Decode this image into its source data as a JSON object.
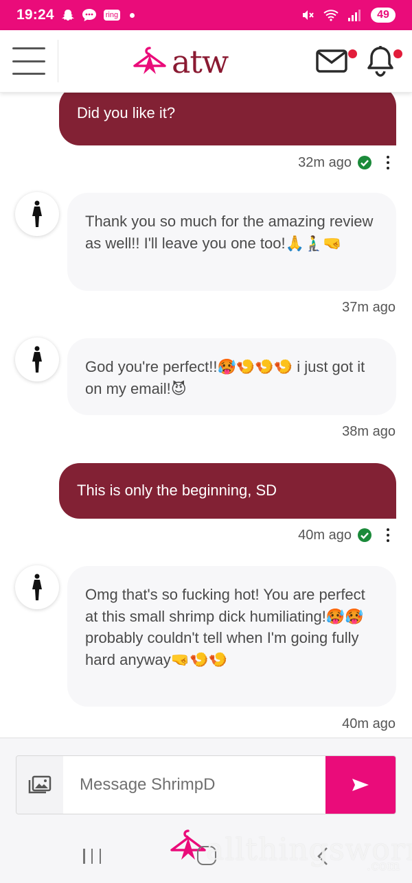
{
  "status_bar": {
    "time": "19:24",
    "ring_label": "ring",
    "battery": "49"
  },
  "header": {
    "logo_text": "atw",
    "brand_color": "#822134",
    "accent_color": "#ea0c7a"
  },
  "messages": [
    {
      "direction": "out",
      "text": "Did you like it?",
      "time": "32m ago",
      "read": true
    },
    {
      "direction": "in",
      "text": "Thank you so much for the amazing review as well!! I'll leave you one too!🙏🧎‍♂️🤜",
      "time": "37m ago"
    },
    {
      "direction": "in",
      "text": "God you're perfect!!🥵🍤🍤🍤 i just got it on my email!😈",
      "time": "38m ago"
    },
    {
      "direction": "out",
      "text": "This is only the beginning, SD",
      "time": "40m ago",
      "read": true
    },
    {
      "direction": "in",
      "text": "Omg that's so fucking hot! You are perfect at this small shrimp dick humiliating!🥵🥵 probably couldn't tell when I'm going fully hard anyway🤜🍤🍤",
      "time": "40m ago"
    }
  ],
  "compose": {
    "placeholder": "Message ShrimpD"
  },
  "watermark": {
    "text": "allthingsworn",
    "sub": ".com"
  }
}
